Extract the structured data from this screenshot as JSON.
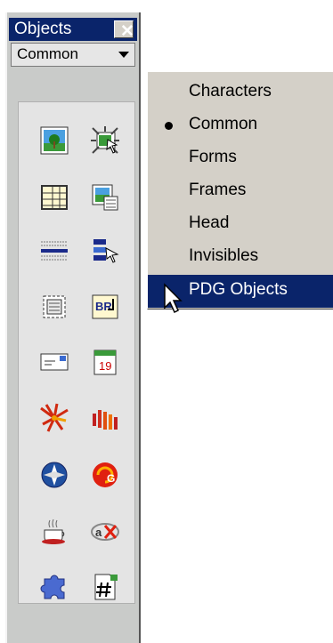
{
  "panel": {
    "title": "Objects",
    "close_glyph": "✕",
    "category_selected": "Common",
    "icons": [
      "image-icon",
      "rollover-image-icon",
      "table-icon",
      "tabular-data-icon",
      "horizontal-rule-icon",
      "navigation-bar-icon",
      "layer-icon",
      "line-break-icon",
      "email-link-icon",
      "date-icon",
      "flash-icon",
      "shockwave-icon",
      "generator-icon",
      "fireworks-icon",
      "applet-icon",
      "activex-icon",
      "plugin-icon",
      "server-side-include-icon"
    ]
  },
  "menu": {
    "items": [
      {
        "label": "Characters",
        "checked": false,
        "highlighted": false
      },
      {
        "label": "Common",
        "checked": true,
        "highlighted": false
      },
      {
        "label": "Forms",
        "checked": false,
        "highlighted": false
      },
      {
        "label": "Frames",
        "checked": false,
        "highlighted": false
      },
      {
        "label": "Head",
        "checked": false,
        "highlighted": false
      },
      {
        "label": "Invisibles",
        "checked": false,
        "highlighted": false
      },
      {
        "label": "PDG Objects",
        "checked": false,
        "highlighted": true
      }
    ]
  },
  "colors": {
    "title_bar": "#0a246a",
    "highlight": "#0a246a",
    "panel_bg": "#c9cbc9",
    "menu_bg": "#d4d0c8"
  }
}
